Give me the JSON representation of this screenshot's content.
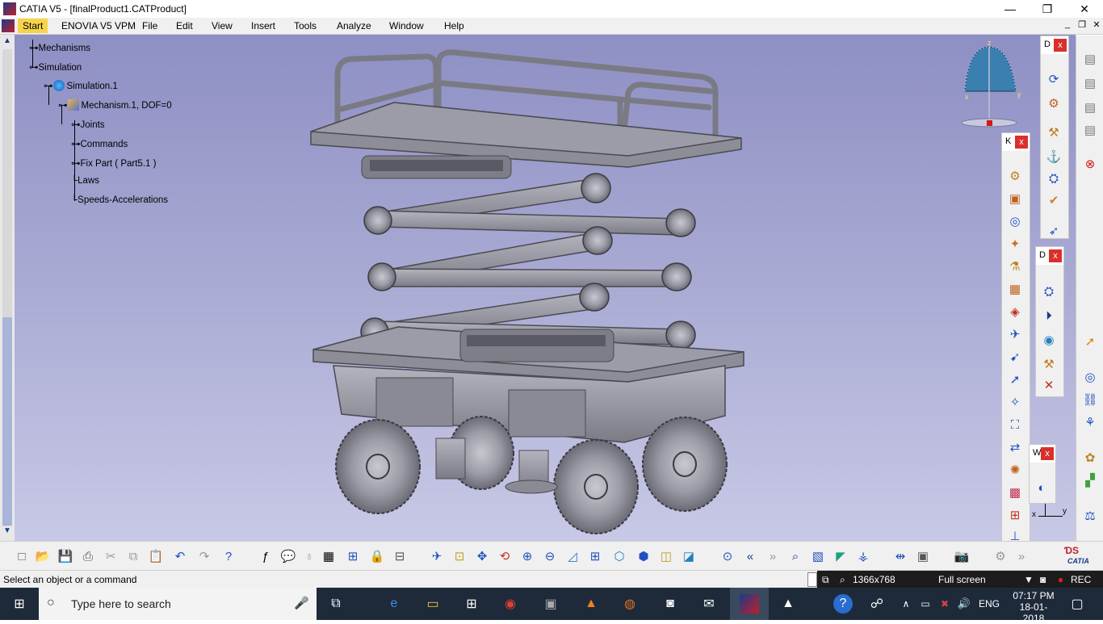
{
  "window": {
    "title": "CATIA V5 - [finalProduct1.CATProduct]",
    "minimize": "—",
    "restore": "❐",
    "close": "✕"
  },
  "menubar": {
    "items": [
      "Start",
      "ENOVIA V5 VPM",
      "File",
      "Edit",
      "View",
      "Insert",
      "Tools",
      "Analyze",
      "Window",
      "Help"
    ],
    "mdi_min": "_",
    "mdi_restore": "❐",
    "mdi_close": "✕"
  },
  "tree": {
    "nodes": [
      {
        "label": "Mechanisms"
      },
      {
        "label": "Simulation"
      },
      {
        "label": "Simulation.1"
      },
      {
        "label": "Mechanism.1, DOF=0"
      },
      {
        "label": "Joints"
      },
      {
        "label": "Commands"
      },
      {
        "label": "Fix Part ( Part5.1 )"
      },
      {
        "label": "Laws"
      },
      {
        "label": "Speeds-Accelerations"
      }
    ]
  },
  "compass": {
    "z": "z",
    "x": "x",
    "y": "y"
  },
  "axes_indicator": {
    "x": "x",
    "y": "y"
  },
  "panels": {
    "p1": {
      "title": "D",
      "close": "x"
    },
    "p2": {
      "title": "K",
      "close": "x"
    },
    "p3": {
      "title": "D",
      "close": "x"
    },
    "p4": {
      "title": "W",
      "close": "x"
    }
  },
  "statusbar": {
    "message": "Select an object or a command",
    "resolution": "1366x768",
    "mode": "Full screen",
    "rec": "REC"
  },
  "taskbar": {
    "search_placeholder": "Type here to search",
    "language": "ENG",
    "time": "07:17 PM",
    "date": "18-01-2018"
  },
  "brand": {
    "logo_text": "CATIA"
  },
  "colors": {
    "viewport_top": "#8e8fc4",
    "viewport_bottom": "#c8c9e6",
    "model_gray": "#8a8a94",
    "start_menu": "#f7d34a",
    "close_red": "#d9302c"
  }
}
